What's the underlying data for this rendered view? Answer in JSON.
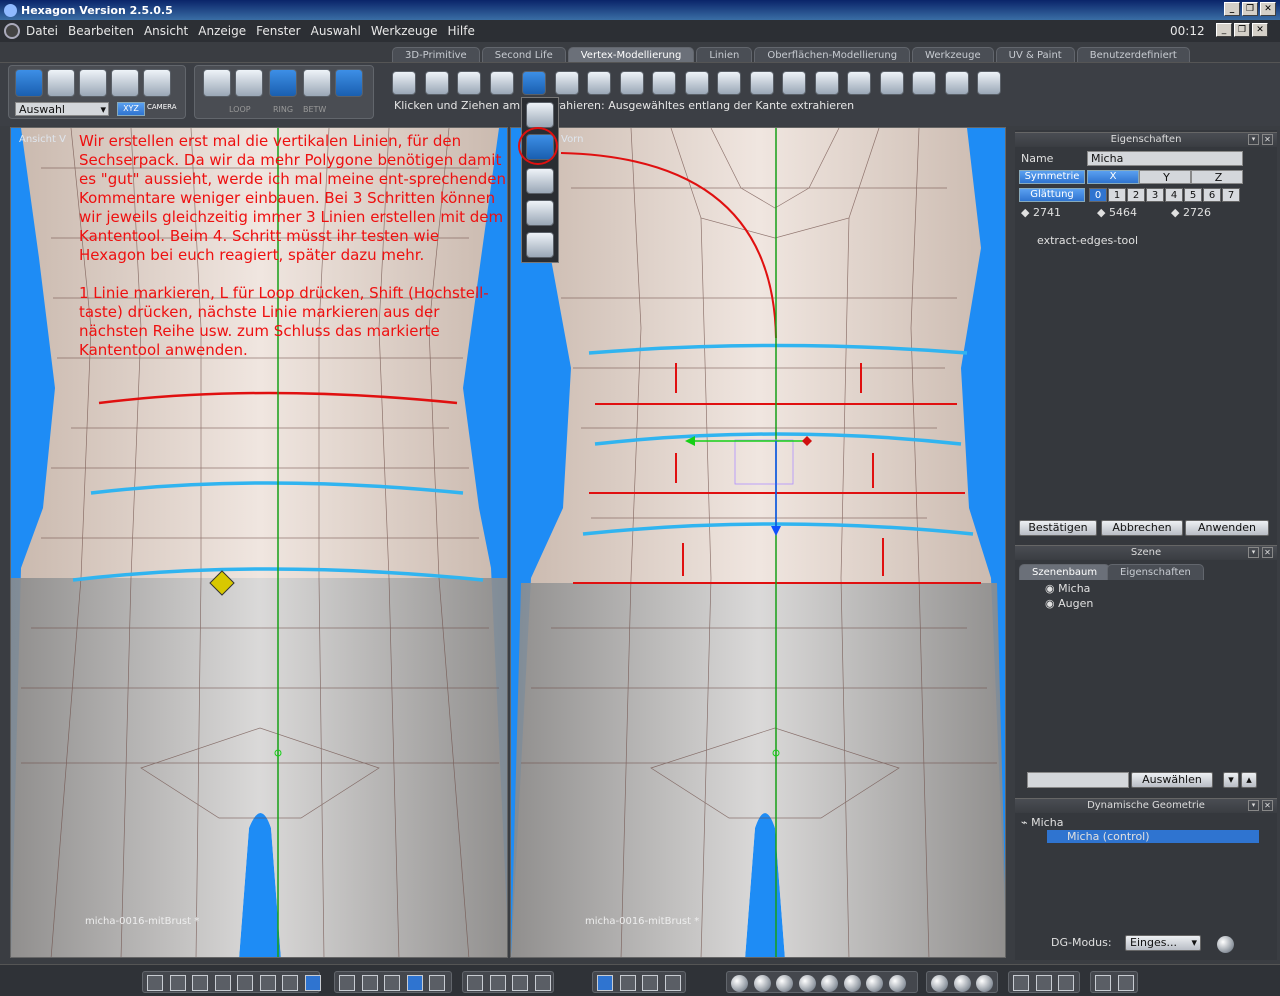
{
  "window": {
    "title": "Hexagon Version 2.5.0.5",
    "clock": "00:12"
  },
  "menu": [
    "Datei",
    "Bearbeiten",
    "Ansicht",
    "Anzeige",
    "Fenster",
    "Auswahl",
    "Werkzeuge",
    "Hilfe"
  ],
  "tabs": [
    {
      "label": "3D-Primitive"
    },
    {
      "label": "Second Life"
    },
    {
      "label": "Vertex-Modellierung",
      "active": true
    },
    {
      "label": "Linien"
    },
    {
      "label": "Oberflächen-Modellierung"
    },
    {
      "label": "Werkzeuge"
    },
    {
      "label": "UV & Paint"
    },
    {
      "label": "Benutzerdefiniert"
    }
  ],
  "toolbar": {
    "selection_dropdown": "Auswahl",
    "xyz_label": "XYZ",
    "camera_label": "CAMERA",
    "loop_label": "LOOP",
    "ring_label": "RING",
    "betw_label": "BETW",
    "hint": "Klicken und Ziehen am ... extrahieren: Ausgewähltes entlang der Kante extrahieren"
  },
  "viewport_left": {
    "label": "Ansicht V",
    "footer": "micha-0016-mitBrust *",
    "comment": "Wir erstellen erst mal die vertikalen Linien, für den Sechserpack. Da wir da mehr Polygone benötigen damit es \"gut\" aussieht, werde ich mal meine ent-sprechenden Kommentare weniger einbauen. Bei 3 Schritten können wir jeweils gleichzeitig immer 3 Linien erstellen mit dem Kantentool. Beim 4. Schritt müsst ihr testen wie Hexagon bei euch reagiert, später dazu mehr.\n\n1 Linie markieren, L für Loop drücken, Shift (Hochstell-taste) drücken, nächste Linie markieren aus der nächsten Reihe usw. zum Schluss das markierte Kantentool anwenden."
  },
  "viewport_right": {
    "label": "Vorn",
    "footer": "micha-0016-mitBrust *"
  },
  "properties": {
    "header": "Eigenschaften",
    "name_label": "Name",
    "name_value": "Micha",
    "symmetry_label": "Symmetrie",
    "axes": [
      "X",
      "Y",
      "Z"
    ],
    "smoothing_label": "Glättung",
    "smoothing_levels": [
      "0",
      "1",
      "2",
      "3",
      "4",
      "5",
      "6",
      "7"
    ],
    "smoothing_selected": "0",
    "stats": [
      "2741",
      "5464",
      "2726"
    ],
    "tool_name": "extract-edges-tool",
    "confirm": "Bestätigen",
    "cancel": "Abbrechen",
    "apply": "Anwenden"
  },
  "scene": {
    "header": "Szene",
    "tabs": [
      "Szenenbaum",
      "Eigenschaften"
    ],
    "items": [
      "Micha",
      "Augen"
    ],
    "select_button": "Auswählen"
  },
  "dynamic": {
    "header": "Dynamische Geometrie",
    "items": [
      "Micha",
      "Micha (control)"
    ],
    "mode_label": "DG-Modus:",
    "mode_value": "Einges..."
  },
  "colors": {
    "accent": "#2f74d0",
    "annotation": "#ee1010",
    "edges_selected": "#30b4f0"
  }
}
